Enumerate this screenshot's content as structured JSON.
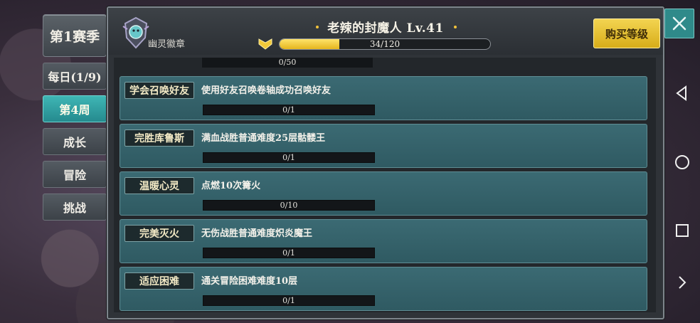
{
  "sidebar": {
    "season_label": "第1赛季",
    "tabs": [
      {
        "label": "每日(1/9)",
        "active": false
      },
      {
        "label": "第4周",
        "active": true
      },
      {
        "label": "成长",
        "active": false
      },
      {
        "label": "冒险",
        "active": false
      },
      {
        "label": "挑战",
        "active": false
      }
    ]
  },
  "header": {
    "badge_label": "幽灵徽章",
    "player_name": "老辣的封魔人 Lv.41",
    "xp_text": "34/120",
    "xp_fraction": 0.283,
    "buy_label": "购买等级"
  },
  "colors": {
    "accent": "#2f8a8a",
    "gold": "#e5b51d",
    "card": "#346169"
  },
  "icons": {
    "badge": "ghost-badge-icon",
    "level": "level-chevron-icon",
    "close": "close-icon"
  },
  "tasks": {
    "top_partial_progress": "0/50",
    "items": [
      {
        "tag": "学会召唤好友",
        "desc": "使用好友召唤卷轴成功召唤好友",
        "progress": "0/1"
      },
      {
        "tag": "完胜库鲁斯",
        "desc": "满血战胜普通难度25层骷髅王",
        "progress": "0/1"
      },
      {
        "tag": "温暖心灵",
        "desc": "点燃10次篝火",
        "progress": "0/10"
      },
      {
        "tag": "完美灭火",
        "desc": "无伤战胜普通难度炽炎魔王",
        "progress": "0/1"
      },
      {
        "tag": "适应困难",
        "desc": "通关冒险困难难度10层",
        "progress": "0/1"
      }
    ]
  }
}
